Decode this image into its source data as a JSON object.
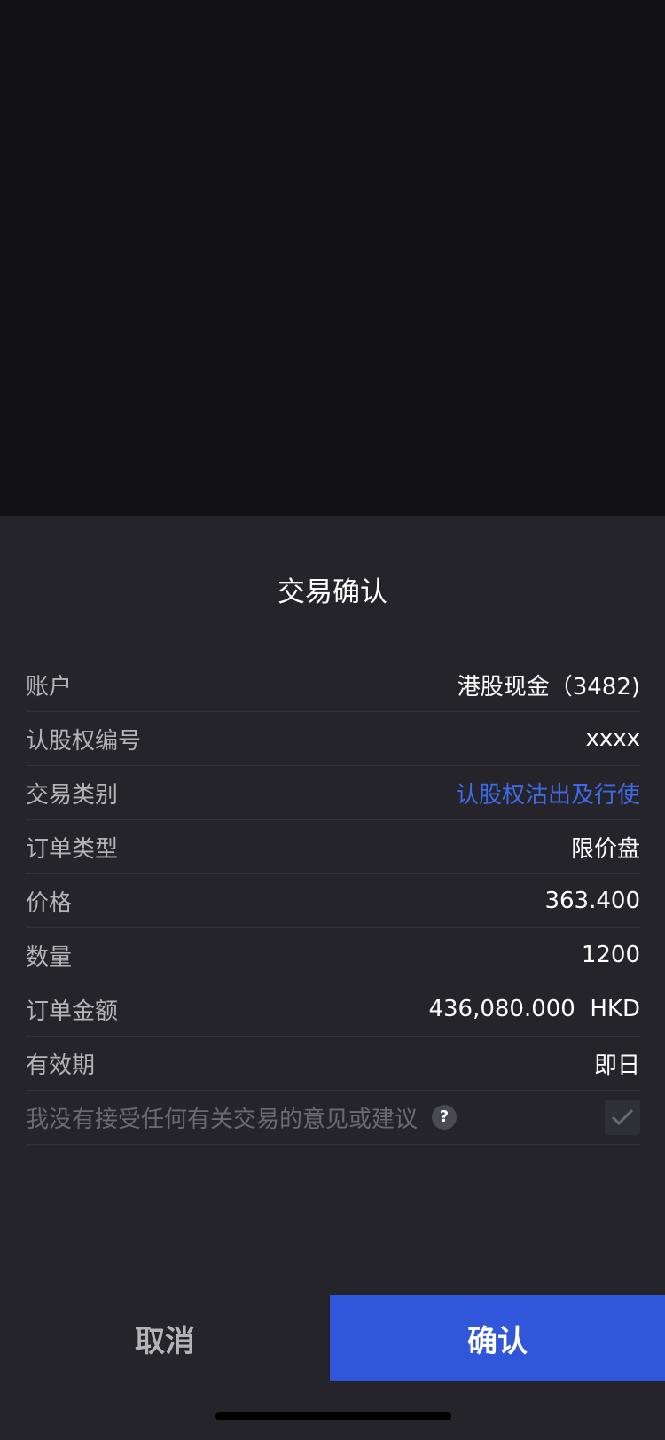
{
  "sheet": {
    "title": "交易确认"
  },
  "details": [
    {
      "label": "账户",
      "value": "港股现金（3482)"
    },
    {
      "label": "认股权编号",
      "value": "xxxx"
    },
    {
      "label": "交易类别",
      "value": "认股权沽出及行使"
    },
    {
      "label": "订单类型",
      "value": "限价盘"
    },
    {
      "label": "价格",
      "value": "363.400"
    },
    {
      "label": "数量",
      "value": "1200"
    },
    {
      "label": "订单金额",
      "value": "436,080.000  HKD"
    },
    {
      "label": "有效期",
      "value": "即日"
    }
  ],
  "agreement": {
    "text": "我没有接受任何有关交易的意见或建议",
    "help_icon": "?",
    "checked": true
  },
  "footer": {
    "cancel_label": "取消",
    "confirm_label": "确认"
  },
  "colors": {
    "accent": "#3057d9",
    "link_blue": "#3d6be8",
    "sheet_bg": "#24242a",
    "overlay_bg": "#121214"
  }
}
